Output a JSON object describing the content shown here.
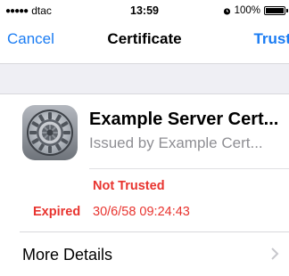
{
  "status_bar": {
    "carrier": "dtac",
    "signal_dots": "●●●●●",
    "time": "13:59",
    "battery": "100%"
  },
  "nav": {
    "cancel_label": "Cancel",
    "title": "Certificate",
    "trust_label": "Trust"
  },
  "certificate": {
    "name": "Example Server Cert...",
    "issued_by": "Issued by Example Cert...",
    "trust_status": "Not Trusted",
    "expired_label": "Expired",
    "expired_value": "30/6/58 09:24:43"
  },
  "details": {
    "label": "More Details"
  },
  "colors": {
    "accent": "#1a7cf3",
    "danger": "#e8342f",
    "secondary_text": "#8e8e93",
    "section_bg": "#efeff4"
  },
  "icons": {
    "app_icon": "settings-gear-icon",
    "alarm": "alarm-icon",
    "chevron": "chevron-right-icon"
  }
}
